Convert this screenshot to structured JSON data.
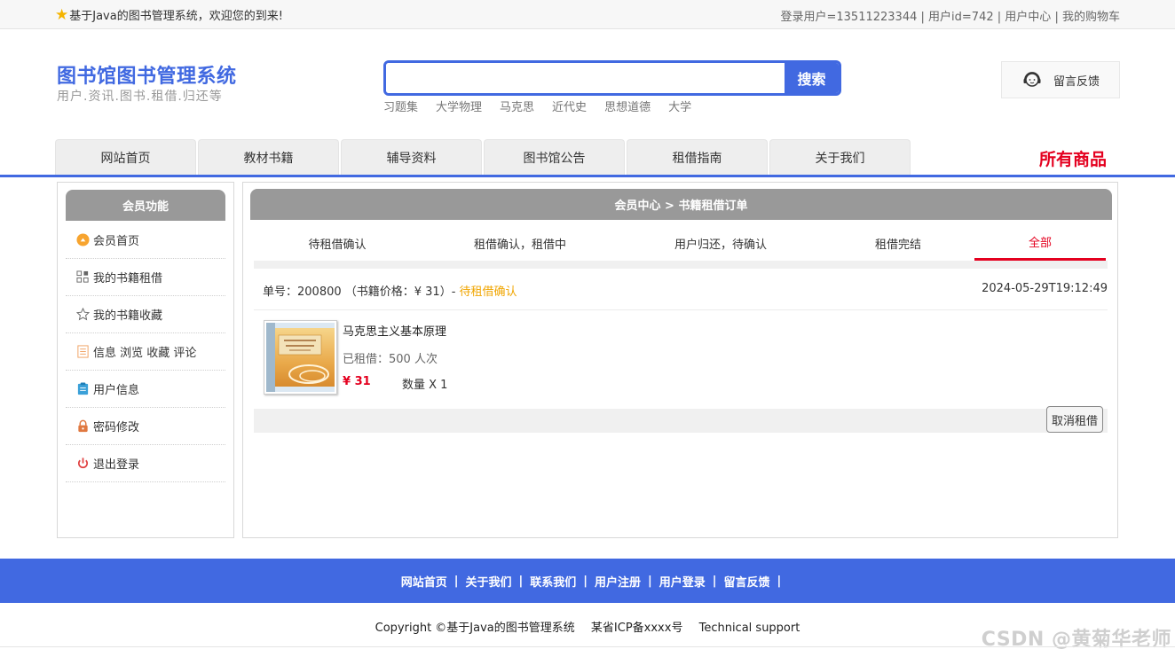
{
  "topbar": {
    "welcome": "基于Java的图书管理系统，欢迎您的到来!",
    "login_user": "登录用户=13511223344",
    "user_id": "用户id=742",
    "user_center": "用户中心",
    "cart": "我的购物车",
    "divider": "|"
  },
  "header": {
    "title": "图书馆图书管理系统",
    "subtitle": "用户.资讯.图书.租借.归还等",
    "search_value": "",
    "search_button": "搜索",
    "hot_words": [
      "习题集",
      "大学物理",
      "马克思",
      "近代史",
      "思想道德",
      "大学"
    ],
    "feedback": "留言反馈"
  },
  "nav": {
    "tabs": [
      "网站首页",
      "教材书籍",
      "辅导资料",
      "图书馆公告",
      "租借指南",
      "关于我们"
    ],
    "all_goods": "所有商品"
  },
  "sidebar": {
    "title": "会员功能",
    "items": [
      {
        "label": "会员首页",
        "icon": "member-home-icon",
        "color": "#f7a42f"
      },
      {
        "label": "我的书籍租借",
        "icon": "grid-icon",
        "color": "#666666"
      },
      {
        "label": "我的书籍收藏",
        "icon": "star-outline-icon",
        "color": "#666666"
      },
      {
        "label": "信息 浏览 收藏 评论",
        "icon": "document-icon",
        "color": "#f0a060"
      },
      {
        "label": "用户信息",
        "icon": "clipboard-icon",
        "color": "#3aa0d8"
      },
      {
        "label": "密码修改",
        "icon": "lock-icon",
        "color": "#e07840"
      },
      {
        "label": "退出登录",
        "icon": "power-icon",
        "color": "#e04040"
      }
    ]
  },
  "main": {
    "breadcrumb": "会员中心 > 书籍租借订单",
    "tabs": [
      "待租借确认",
      "租借确认，租借中",
      "用户归还，待确认",
      "租借完结",
      "全部"
    ],
    "active_tab": "全部",
    "order": {
      "header_prefix": "单号：200800 （书籍价格：¥ 31）-",
      "status": "待租借确认",
      "time": "2024-05-29T19:12:49",
      "book_name": "马克思主义基本原理",
      "borrowed": "已租借：500 人次",
      "price": "¥ 31",
      "quantity": "数量 X 1",
      "cancel": "取消租借"
    }
  },
  "footer": {
    "links": [
      "网站首页",
      "关于我们",
      "联系我们",
      "用户注册",
      "用户登录",
      "留言反馈"
    ],
    "divider": "|",
    "copyright": "Copyright ©基于Java的图书管理系统",
    "icp": "某省ICP备xxxx号",
    "support": "Technical support",
    "watermark": "CSDN @黄菊华老师"
  },
  "colors": {
    "accent": "#4169e1",
    "highlight": "#e4001f",
    "status": "#f0a500"
  }
}
